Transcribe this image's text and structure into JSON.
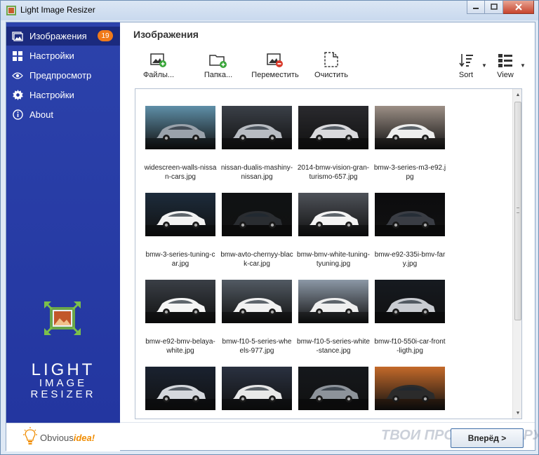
{
  "window": {
    "title": "Light Image Resizer",
    "minimize_glyph": "–",
    "maximize_glyph": "□",
    "close_glyph": "✕"
  },
  "sidebar": {
    "items": [
      {
        "label": "Изображения",
        "icon": "images-icon",
        "active": true,
        "badge": "19"
      },
      {
        "label": "Настройки",
        "icon": "grid-icon",
        "active": false
      },
      {
        "label": "Предпросмотр",
        "icon": "eye-icon",
        "active": false
      },
      {
        "label": "Настройки",
        "icon": "gear-icon",
        "active": false
      },
      {
        "label": "About",
        "icon": "info-icon",
        "active": false
      }
    ],
    "brand_line1": "LIGHT",
    "brand_line2": "IMAGE",
    "brand_line3": "RESIZER",
    "footer_brand_a": "Obvious",
    "footer_brand_b": "idea!"
  },
  "main": {
    "title": "Изображения",
    "toolbar": {
      "files": "Файлы...",
      "folder": "Папка...",
      "move": "Переместить",
      "clear": "Очистить",
      "sort": "Sort",
      "view": "View"
    },
    "images": [
      {
        "caption": "widescreen-walls-nissan-cars.jpg",
        "bg": "#5f8fa8",
        "car": "#9aa2ab"
      },
      {
        "caption": "nissan-dualis-mashiny-nissan.jpg",
        "bg": "#3b4048",
        "car": "#b8bcc2"
      },
      {
        "caption": "2014-bmw-vision-gran-turismo-657.jpg",
        "bg": "#2a2a2e",
        "car": "#d9d9dc"
      },
      {
        "caption": "bmw-3-series-m3-e92.jpg",
        "bg": "#9c8f86",
        "car": "#eeeeee"
      },
      {
        "caption": "bmw-3-series-tuning-car.jpg",
        "bg": "#1d2c3c",
        "car": "#f2f2f2"
      },
      {
        "caption": "bmw-avto-chernyy-black-car.jpg",
        "bg": "#101214",
        "car": "#2a2d31"
      },
      {
        "caption": "bmw-bmv-white-tuning-tyuning.jpg",
        "bg": "#4e5259",
        "car": "#f4f4f4"
      },
      {
        "caption": "bmw-e92-335i-bmv-fary.jpg",
        "bg": "#0c0c0e",
        "car": "#3a3d44"
      },
      {
        "caption": "bmw-e92-bmv-belaya-white.jpg",
        "bg": "#3a3f46",
        "car": "#f5f5f5"
      },
      {
        "caption": "bmw-f10-5-series-wheels-977.jpg",
        "bg": "#525a63",
        "car": "#f1f1f1"
      },
      {
        "caption": "bmw-f10-5-series-white-stance.jpg",
        "bg": "#8c98a6",
        "car": "#efefef"
      },
      {
        "caption": "bmw-f10-550i-car-front-ligth.jpg",
        "bg": "#161a20",
        "car": "#c9ccd1"
      },
      {
        "caption": "",
        "bg": "#1a2230",
        "car": "#d5d8dd"
      },
      {
        "caption": "",
        "bg": "#2a3140",
        "car": "#e8e8e8"
      },
      {
        "caption": "",
        "bg": "#15181c",
        "car": "#8d939a"
      },
      {
        "caption": "",
        "bg": "#c46a2a",
        "car": "#2b2b2b"
      }
    ],
    "scroll_up_glyph": "▲",
    "scroll_down_glyph": "▼",
    "watermark": "ТВОИ ПРОГРАММЫ.РУ",
    "next_button": "Вперёд >"
  }
}
